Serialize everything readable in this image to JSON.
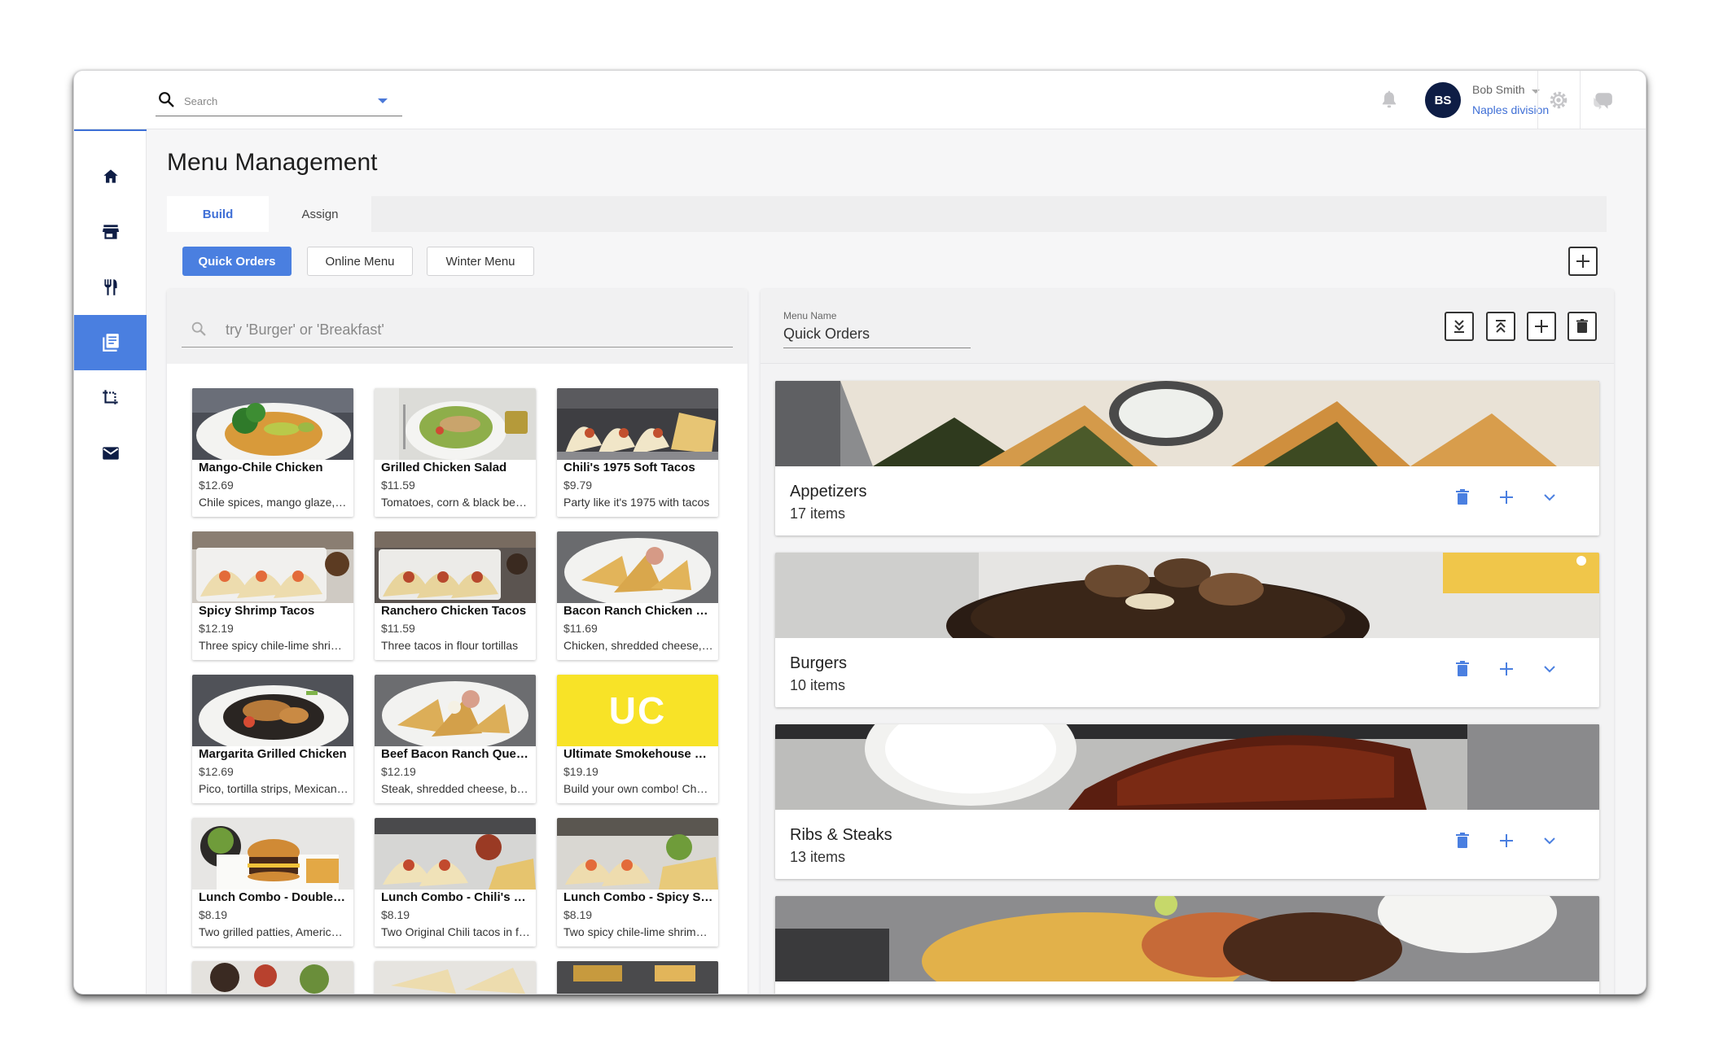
{
  "topbar": {
    "search_placeholder": "Search",
    "user": {
      "initials": "BS",
      "name": "Bob Smith",
      "division": "Naples division"
    }
  },
  "sidebar": {
    "items": [
      {
        "icon": "home-icon",
        "active": false
      },
      {
        "icon": "store-icon",
        "active": false
      },
      {
        "icon": "utensils-icon",
        "active": false
      },
      {
        "icon": "menu-book-icon",
        "active": true
      },
      {
        "icon": "crop-icon",
        "active": false
      },
      {
        "icon": "mail-icon",
        "active": false
      }
    ]
  },
  "page": {
    "title": "Menu Management",
    "tabs": [
      {
        "label": "Build",
        "active": true
      },
      {
        "label": "Assign",
        "active": false
      }
    ],
    "menus": [
      {
        "label": "Quick Orders",
        "active": true
      },
      {
        "label": "Online Menu",
        "active": false
      },
      {
        "label": "Winter Menu",
        "active": false
      }
    ]
  },
  "items_panel": {
    "search_placeholder": "try 'Burger' or 'Breakfast'",
    "items": [
      {
        "name": "Mango-Chile Chicken",
        "price": "$12.69",
        "desc": "Chile spices, mango glaze, avocado"
      },
      {
        "name": "Grilled Chicken Salad",
        "price": "$11.59",
        "desc": "Tomatoes, corn & black beans"
      },
      {
        "name": "Chili's 1975 Soft Tacos",
        "price": "$9.79",
        "desc": "Party like it's 1975 with tacos"
      },
      {
        "name": "Spicy Shrimp Tacos",
        "price": "$12.19",
        "desc": "Three spicy chile-lime shrimp tacos"
      },
      {
        "name": "Ranchero Chicken Tacos",
        "price": "$11.59",
        "desc": "Three tacos in flour tortillas"
      },
      {
        "name": "Bacon Ranch Chicken Quesadillas",
        "price": "$11.69",
        "desc": "Chicken, shredded cheese, bacon"
      },
      {
        "name": "Margarita Grilled Chicken",
        "price": "$12.69",
        "desc": "Pico, tortilla strips, Mexican rice"
      },
      {
        "name": "Beef Bacon Ranch Quesadillas",
        "price": "$12.19",
        "desc": "Steak, shredded cheese, bacon"
      },
      {
        "name": "Ultimate Smokehouse Combo",
        "price": "$19.19",
        "desc": "Build your own combo! Choose two",
        "placeholder_initials": "UC"
      },
      {
        "name": "Lunch Combo - Double Burger",
        "price": "$8.19",
        "desc": "Two grilled patties, American cheese"
      },
      {
        "name": "Lunch Combo - Chili's Tacos",
        "price": "$8.19",
        "desc": "Two Original Chili tacos in flour"
      },
      {
        "name": "Lunch Combo - Spicy Shrimp Tacos",
        "price": "$8.19",
        "desc": "Two spicy chile-lime shrimp tacos"
      }
    ]
  },
  "menu_panel": {
    "menu_name_label": "Menu Name",
    "menu_name_value": "Quick Orders",
    "categories": [
      {
        "title": "Appetizers",
        "count": "17 items"
      },
      {
        "title": "Burgers",
        "count": "10 items"
      },
      {
        "title": "Ribs & Steaks",
        "count": "13 items"
      },
      {
        "title": "",
        "count": ""
      }
    ]
  },
  "colors": {
    "accent": "#4a7fe0",
    "link": "#3f6fd6",
    "avatar": "#0e1d45",
    "uc_yellow": "#f8e327"
  }
}
